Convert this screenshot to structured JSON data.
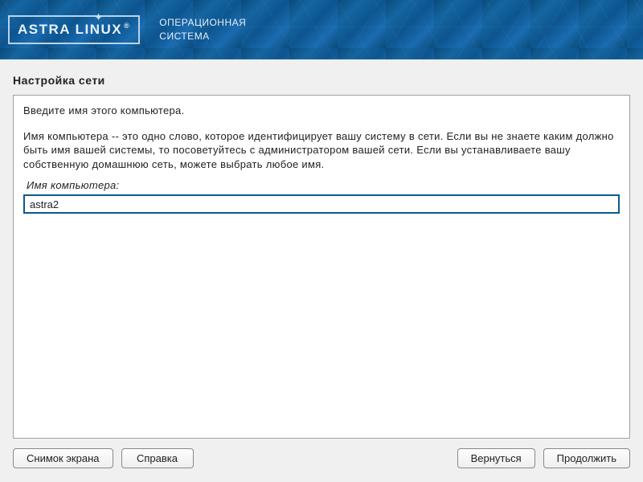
{
  "header": {
    "logo_text": "ASTRA LINUX",
    "subtitle_line1": "ОПЕРАЦИОННАЯ",
    "subtitle_line2": "СИСТЕМА"
  },
  "page": {
    "title": "Настройка сети"
  },
  "panel": {
    "instruction1": "Введите имя этого компьютера.",
    "instruction2": "Имя компьютера -- это одно слово, которое идентифицирует вашу систему в сети. Если вы не знаете каким должно быть имя вашей системы, то посоветуйтесь с администратором вашей сети. Если вы устанавливаете вашу собственную домашнюю сеть, можете выбрать любое имя.",
    "field_label": "Имя компьютера:",
    "field_value": "astra2"
  },
  "buttons": {
    "screenshot": "Снимок экрана",
    "help": "Справка",
    "back": "Вернуться",
    "continue": "Продолжить"
  }
}
